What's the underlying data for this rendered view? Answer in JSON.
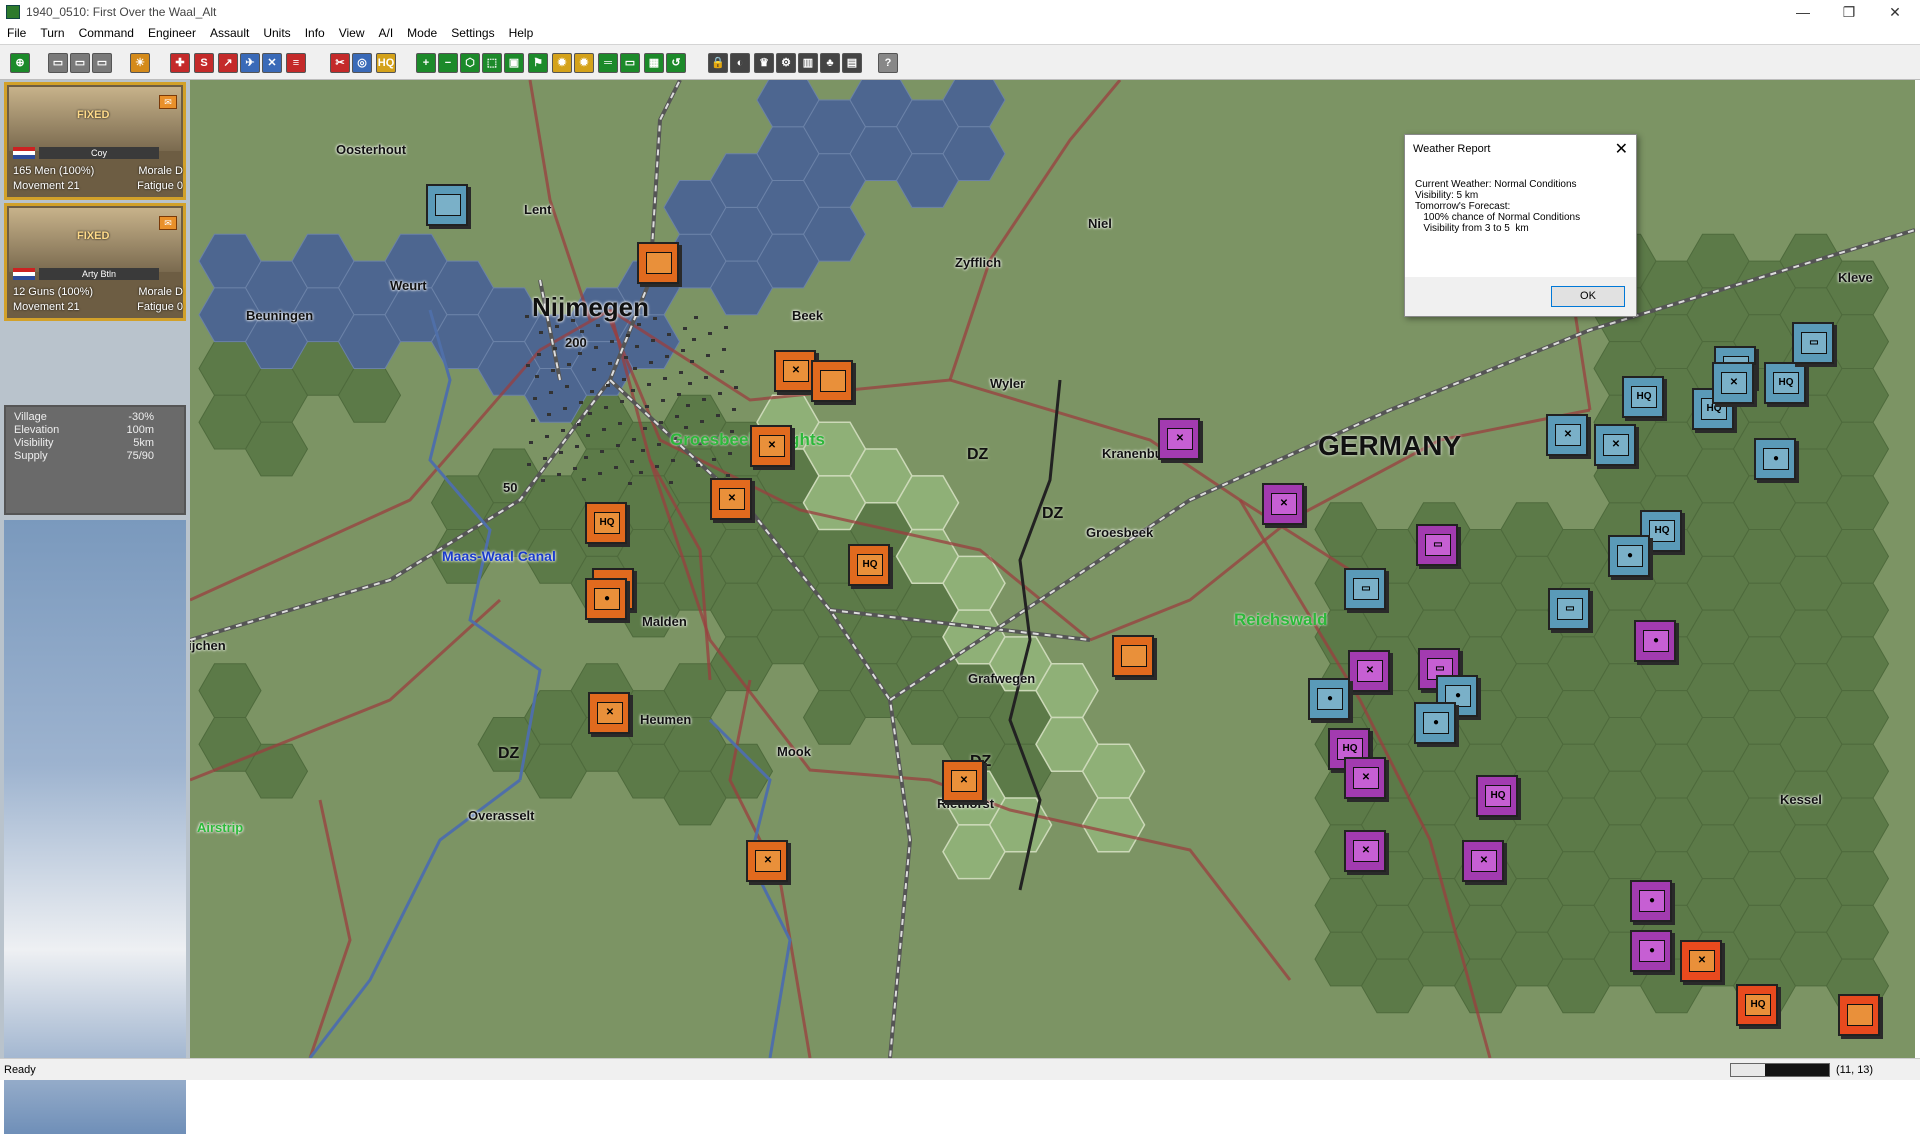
{
  "window": {
    "title": "1940_0510: First Over the Waal_Alt",
    "controls": [
      "—",
      "❐",
      "✕"
    ]
  },
  "menu": [
    "File",
    "Turn",
    "Command",
    "Engineer",
    "Assault",
    "Units",
    "Info",
    "View",
    "A/I",
    "Mode",
    "Settings",
    "Help"
  ],
  "toolbar": {
    "icons": [
      "center-icon",
      "load-icon",
      "open-icon",
      "save-icon",
      "report-icon",
      "flag-icon",
      "supply-icon",
      "artillery-icon",
      "air-icon",
      "cross-icon",
      "list-icon",
      "engineer-icon",
      "radio-icon",
      "hq-icon",
      "zoom-in-icon",
      "zoom-out-icon",
      "hex-icon",
      "fit-icon",
      "unit-icon",
      "flag-green-icon",
      "sun-icon",
      "sun-alt-icon",
      "bridge-icon",
      "screen-icon",
      "map-icon",
      "replay-icon",
      "lock-icon",
      "mask-icon",
      "trophy-icon",
      "gear-icon",
      "building-icon",
      "tree-icon",
      "scroll-icon",
      "help-icon"
    ],
    "colors": [
      "#1c8a2a",
      "#7a7a7a",
      "#7a7a7a",
      "#7a7a7a",
      "#d48a1a",
      "#c42a2a",
      "#c42a2a",
      "#c42a2a",
      "#3a6ab8",
      "#3a6ab8",
      "#c42a2a",
      "#c42a2a",
      "#3a6ab8",
      "#d4a21a",
      "#1c8a2a",
      "#1c8a2a",
      "#1c8a2a",
      "#1c8a2a",
      "#1c8a2a",
      "#1c8a2a",
      "#d4a21a",
      "#d4a21a",
      "#1c8a2a",
      "#1c8a2a",
      "#1c8a2a",
      "#1c8a2a",
      "#444444",
      "#444444",
      "#444444",
      "#444444",
      "#444444",
      "#444444",
      "#444444",
      "#888888"
    ],
    "glyphs": [
      "⊕",
      "▭",
      "▭",
      "▭",
      "☀",
      "✚",
      "S",
      "↗",
      "✈",
      "✕",
      "≡",
      "✂",
      "◎",
      "HQ",
      "+",
      "−",
      "⬡",
      "⬚",
      "▣",
      "⚑",
      "✹",
      "✹",
      "═",
      "▭",
      "▦",
      "↺",
      "🔒",
      "◐",
      "♛",
      "⚙",
      "▥",
      "♣",
      "▤",
      "?"
    ]
  },
  "unit_cards": [
    {
      "status": "FIXED",
      "type": "Coy",
      "strength": "165 Men (100%)",
      "morale": "Morale D",
      "movement": "Movement 21",
      "fatigue": "Fatigue 0"
    },
    {
      "status": "FIXED",
      "type": "Arty Btln",
      "strength": "12 Guns (100%)",
      "morale": "Morale D",
      "movement": "Movement 21",
      "fatigue": "Fatigue 0"
    }
  ],
  "hex_info": [
    {
      "label": "Village",
      "value": "-30%"
    },
    {
      "label": "Elevation",
      "value": "100m"
    },
    {
      "label": "Visibility",
      "value": "5km"
    },
    {
      "label": "Supply",
      "value": "75/90"
    }
  ],
  "map_labels": [
    {
      "text": "Oosterhout",
      "style": ""
    },
    {
      "text": "Lent",
      "style": ""
    },
    {
      "text": "Weurt",
      "style": ""
    },
    {
      "text": "Beuningen",
      "style": ""
    },
    {
      "text": "Nijmegen",
      "style": "big"
    },
    {
      "text": "200",
      "style": ""
    },
    {
      "text": "Beek",
      "style": ""
    },
    {
      "text": "Groesbeek Heights",
      "style": "green"
    },
    {
      "text": "Zyfflich",
      "style": ""
    },
    {
      "text": "Niel",
      "style": ""
    },
    {
      "text": "Wyler",
      "style": ""
    },
    {
      "text": "Kranenburg",
      "style": ""
    },
    {
      "text": "GERMANY",
      "style": "germ"
    },
    {
      "text": "Kleve",
      "style": ""
    },
    {
      "text": "50",
      "style": ""
    },
    {
      "text": "Maas-Waal Canal",
      "style": "blue"
    },
    {
      "text": "Groesbeek",
      "style": ""
    },
    {
      "text": "DZ",
      "style": "dz"
    },
    {
      "text": "DZ",
      "style": "dz"
    },
    {
      "text": "DZ",
      "style": "dz"
    },
    {
      "text": "DZ",
      "style": "dz"
    },
    {
      "text": "Wijchen",
      "style": ""
    },
    {
      "text": "Malden",
      "style": ""
    },
    {
      "text": "Heumen",
      "style": ""
    },
    {
      "text": "Mook",
      "style": ""
    },
    {
      "text": "Grafwegen",
      "style": ""
    },
    {
      "text": "Reichswald",
      "style": "green"
    },
    {
      "text": "Riethorst",
      "style": ""
    },
    {
      "text": "Overasselt",
      "style": ""
    },
    {
      "text": "Airstrip",
      "style": "airstrip"
    },
    {
      "text": "Kessel",
      "style": ""
    }
  ],
  "counters": [
    {
      "side": "bl",
      "sym": ""
    },
    {
      "side": "or",
      "sym": ""
    },
    {
      "side": "or",
      "sym": "✕"
    },
    {
      "side": "or",
      "sym": "✕"
    },
    {
      "side": "or",
      "sym": ""
    },
    {
      "side": "or",
      "sym": "✕"
    },
    {
      "side": "or",
      "sym": "HQ"
    },
    {
      "side": "or",
      "sym": "✕"
    },
    {
      "side": "or",
      "sym": "HQ"
    },
    {
      "side": "or",
      "sym": "●"
    },
    {
      "side": "or",
      "sym": ""
    },
    {
      "side": "or",
      "sym": "✕"
    },
    {
      "side": "or",
      "sym": "✕"
    },
    {
      "side": "or",
      "sym": "✕"
    },
    {
      "side": "or",
      "sym": ""
    },
    {
      "side": "pu",
      "sym": "✕"
    },
    {
      "side": "pu",
      "sym": "✕"
    },
    {
      "side": "pu",
      "sym": "▭"
    },
    {
      "side": "bl",
      "sym": "▭"
    },
    {
      "side": "pu",
      "sym": "✕"
    },
    {
      "side": "bl",
      "sym": "●"
    },
    {
      "side": "pu",
      "sym": "▭"
    },
    {
      "side": "bl",
      "sym": "●"
    },
    {
      "side": "pu",
      "sym": "HQ"
    },
    {
      "side": "pu",
      "sym": "✕"
    },
    {
      "side": "bl",
      "sym": "●"
    },
    {
      "side": "pu",
      "sym": "HQ"
    },
    {
      "side": "pu",
      "sym": "✕"
    },
    {
      "side": "pu",
      "sym": "✕"
    },
    {
      "side": "pu",
      "sym": "●"
    },
    {
      "side": "pu",
      "sym": "●"
    },
    {
      "side": "pu",
      "sym": "●"
    },
    {
      "side": "bl",
      "sym": "▭"
    },
    {
      "side": "bl",
      "sym": "✕"
    },
    {
      "side": "bl",
      "sym": "HQ"
    },
    {
      "side": "bl",
      "sym": "HQ"
    },
    {
      "side": "bl",
      "sym": "HQ"
    },
    {
      "side": "bl",
      "sym": "●"
    },
    {
      "side": "bl",
      "sym": "▭"
    },
    {
      "side": "bl",
      "sym": "✕"
    },
    {
      "side": "bl",
      "sym": "HQ"
    },
    {
      "side": "bl",
      "sym": "▭"
    },
    {
      "side": "bl",
      "sym": "✕"
    },
    {
      "side": "bl",
      "sym": "●"
    },
    {
      "side": "rd",
      "sym": "✕"
    },
    {
      "side": "rd",
      "sym": "HQ"
    },
    {
      "side": "rd",
      "sym": "HQ"
    },
    {
      "side": "pu",
      "sym": "✕"
    },
    {
      "side": "pu",
      "sym": "●"
    },
    {
      "side": "rd",
      "sym": ""
    },
    {
      "side": "or",
      "sym": ""
    }
  ],
  "weather": {
    "title": "Weather Report",
    "lines": [
      "Current Weather: Normal Conditions",
      "Visibility: 5 km",
      "Tomorrow's Forecast:",
      "   100% chance of Normal Conditions",
      "   Visibility from 3 to 5  km"
    ],
    "ok": "OK"
  },
  "status": {
    "text": "Ready",
    "coords": "(11, 13)",
    "progress": 0.35
  },
  "colors": {
    "allied": "#e16a1e",
    "german": "#a23bb0",
    "german_hq": "#5a9ab8",
    "river": "#4d6690",
    "forest": "#5c7a48",
    "open": "#7c9464"
  }
}
